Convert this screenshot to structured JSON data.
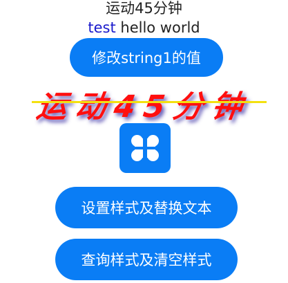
{
  "header": {
    "title": "运动45分钟",
    "hello_prefix": "test",
    "hello_rest": " hello world"
  },
  "buttons": {
    "modify_label": "修改string1的值",
    "set_label": "设置样式及替换文本",
    "query_label": "查询样式及清空样式"
  },
  "styled_text": {
    "text": "运动45分钟",
    "color": "#ff0f0f",
    "shadow_color": "#4a3caa",
    "decoration_color": "#f3e010"
  },
  "icon": {
    "name": "app-grid-icon",
    "background": "#0a7df5"
  },
  "colors": {
    "accent": "#0a7df5",
    "link_blue": "#1a1acc"
  }
}
